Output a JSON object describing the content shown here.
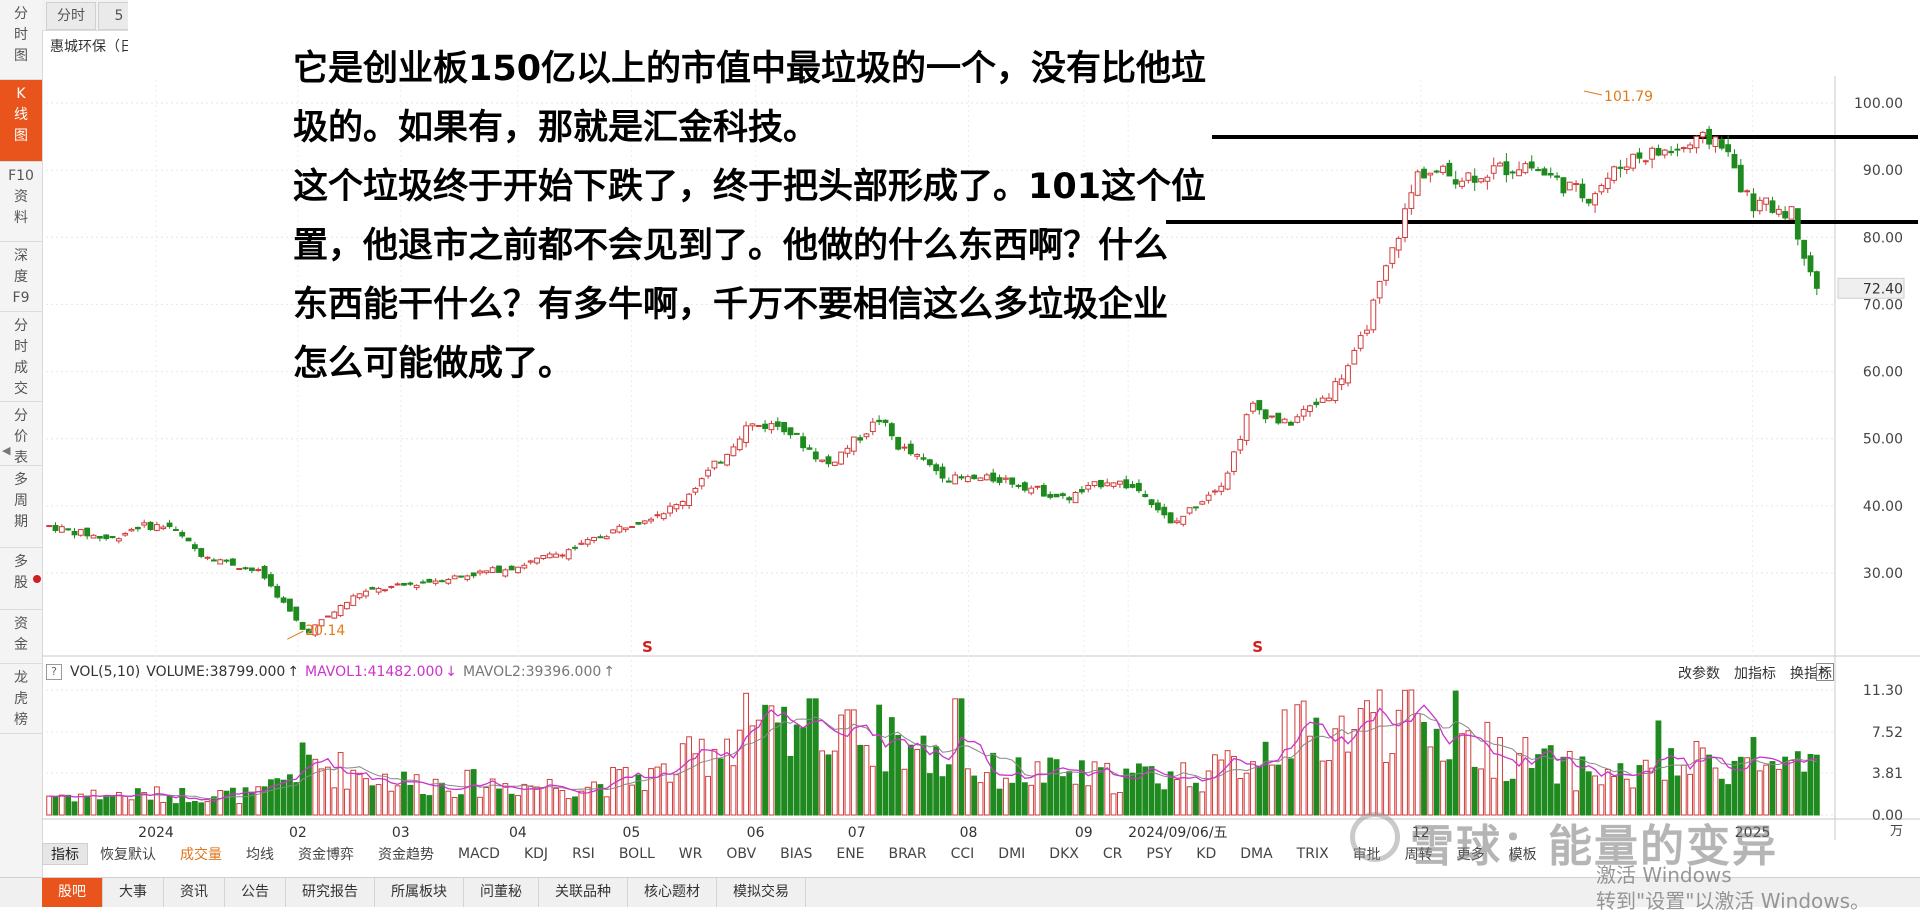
{
  "left_sidebar": {
    "items": [
      {
        "label": "分时图",
        "chars": [
          "分",
          "时",
          "图"
        ],
        "active": false
      },
      {
        "label": "K线图",
        "chars": [
          "K",
          "线",
          "图"
        ],
        "active": true
      },
      {
        "label": "F10资料",
        "chars": [
          "F10",
          "资",
          "料"
        ],
        "active": false
      },
      {
        "label": "深度F9",
        "chars": [
          "深",
          "度",
          "F9"
        ],
        "active": false
      },
      {
        "label": "分时成交",
        "chars": [
          "分",
          "时",
          "成",
          "交"
        ],
        "active": false
      },
      {
        "label": "分价表",
        "chars": [
          "分",
          "价",
          "表"
        ],
        "active": false
      },
      {
        "label": "多周期",
        "chars": [
          "多",
          "周",
          "期"
        ],
        "active": false
      },
      {
        "label": "多股",
        "chars": [
          "多",
          "股"
        ],
        "active": false
      },
      {
        "label": "资金",
        "chars": [
          "资",
          "金"
        ],
        "active": false
      },
      {
        "label": "龙虎榜",
        "chars": [
          "龙",
          "虎",
          "榜"
        ],
        "active": false
      }
    ]
  },
  "top_tabs": [
    "分时",
    "5"
  ],
  "stock_name": "惠城环保（日",
  "annotation_text": [
    "它是创业板150亿以上的市值中最垃圾的一个，没有比他垃",
    "圾的。如果有，那就是汇金科技。",
    "这个垃圾终于开始下跌了，终于把头部形成了。101这个位",
    "置，他退市之前都不会见到了。他做的什么东西啊？什么",
    "东西能干什么？有多牛啊，千万不要相信这么多垃圾企业",
    "怎么可能做成了。"
  ],
  "price_axis": {
    "ticks": [
      "100.00",
      "90.00",
      "80.00",
      "70.00",
      "60.00",
      "50.00",
      "40.00",
      "30.00"
    ],
    "current_price": "72.40"
  },
  "price_annotations": {
    "high_label": "101.79",
    "low_label": "20.14",
    "s_markers": [
      "S",
      "S"
    ]
  },
  "volume_legend": {
    "help": "?",
    "vol": "VOL(5,10)",
    "volume": "VOLUME:38799.000",
    "volume_arrow": "↑",
    "mavol1": "MAVOL1:41482.000",
    "mavol1_arrow": "↓",
    "mavol2": "MAVOL2:39396.000",
    "mavol2_arrow": "↑"
  },
  "volume_tools": [
    "改参数",
    "加指标",
    "换指标"
  ],
  "volume_close": "✕",
  "volume_axis": {
    "ticks": [
      "11.30",
      "7.52",
      "3.81",
      "0.00"
    ],
    "unit": "万"
  },
  "x_axis": {
    "labels": [
      "2024",
      "02",
      "03",
      "04",
      "05",
      "06",
      "07",
      "08",
      "09",
      "2024/09/06/五",
      "12",
      "2025"
    ]
  },
  "indicator_bar": {
    "items": [
      "指标",
      "恢复默认",
      "成交量",
      "均线",
      "资金博弈",
      "资金趋势",
      "MACD",
      "KDJ",
      "RSI",
      "BOLL",
      "WR",
      "OBV",
      "BIAS",
      "ENE",
      "BRAR",
      "CCI",
      "DMI",
      "DKX",
      "CR",
      "PSY",
      "KD",
      "DMA",
      "TRIX",
      "审批",
      "周转",
      "更多",
      "模板"
    ],
    "selected": "指标",
    "highlighted": "成交量"
  },
  "bottom_tabs": {
    "items": [
      "股吧",
      "大事",
      "资讯",
      "公告",
      "研究报告",
      "所属板块",
      "问董秘",
      "关联品种",
      "核心题材",
      "模拟交易"
    ],
    "active": "股吧"
  },
  "watermark_text": "雪球：能量的变异",
  "activate_windows": [
    "激活 Windows",
    "转到\"设置\"以激活 Windows。"
  ],
  "colors": {
    "up": "#d23c3c",
    "down": "#1f8a1f",
    "accent": "#e8541c",
    "mavol1": "#cc33cc",
    "mavol2": "#888888",
    "annotation_label": "#e07b1a"
  },
  "chart_data": {
    "type": "candlestick",
    "series_name": "惠城环保",
    "ylim": [
      20,
      102
    ],
    "price_keypoints": [
      {
        "x": 0.0,
        "p": 37
      },
      {
        "x": 0.035,
        "p": 35
      },
      {
        "x": 0.05,
        "p": 37
      },
      {
        "x": 0.068,
        "p": 37
      },
      {
        "x": 0.085,
        "p": 33
      },
      {
        "x": 0.12,
        "p": 30
      },
      {
        "x": 0.145,
        "p": 21
      },
      {
        "x": 0.16,
        "p": 24
      },
      {
        "x": 0.175,
        "p": 27
      },
      {
        "x": 0.22,
        "p": 29
      },
      {
        "x": 0.265,
        "p": 31
      },
      {
        "x": 0.3,
        "p": 34
      },
      {
        "x": 0.325,
        "p": 37
      },
      {
        "x": 0.355,
        "p": 40
      },
      {
        "x": 0.38,
        "p": 47
      },
      {
        "x": 0.395,
        "p": 52
      },
      {
        "x": 0.415,
        "p": 52
      },
      {
        "x": 0.44,
        "p": 46
      },
      {
        "x": 0.47,
        "p": 53
      },
      {
        "x": 0.48,
        "p": 49
      },
      {
        "x": 0.51,
        "p": 44
      },
      {
        "x": 0.54,
        "p": 44
      },
      {
        "x": 0.575,
        "p": 41
      },
      {
        "x": 0.6,
        "p": 44
      },
      {
        "x": 0.62,
        "p": 42
      },
      {
        "x": 0.635,
        "p": 37
      },
      {
        "x": 0.665,
        "p": 44
      },
      {
        "x": 0.68,
        "p": 55
      },
      {
        "x": 0.7,
        "p": 52
      },
      {
        "x": 0.725,
        "p": 57
      },
      {
        "x": 0.74,
        "p": 63
      },
      {
        "x": 0.76,
        "p": 78
      },
      {
        "x": 0.775,
        "p": 90
      },
      {
        "x": 0.8,
        "p": 89
      },
      {
        "x": 0.835,
        "p": 91
      },
      {
        "x": 0.87,
        "p": 86
      },
      {
        "x": 0.895,
        "p": 92
      },
      {
        "x": 0.92,
        "p": 93
      },
      {
        "x": 0.945,
        "p": 95
      },
      {
        "x": 0.962,
        "p": 85
      },
      {
        "x": 0.985,
        "p": 84
      },
      {
        "x": 1.0,
        "p": 72.4
      }
    ],
    "high": 101.79,
    "low": 20.14,
    "horizontal_lines": [
      95,
      83
    ],
    "volume_ylim": [
      0,
      11.3
    ],
    "volume_keypoints": [
      {
        "x": 0.0,
        "v": 1.8
      },
      {
        "x": 0.12,
        "v": 1.8
      },
      {
        "x": 0.145,
        "v": 4.8
      },
      {
        "x": 0.2,
        "v": 3.0
      },
      {
        "x": 0.3,
        "v": 2.6
      },
      {
        "x": 0.35,
        "v": 3.8
      },
      {
        "x": 0.395,
        "v": 8.0
      },
      {
        "x": 0.43,
        "v": 6.0
      },
      {
        "x": 0.47,
        "v": 7.0
      },
      {
        "x": 0.52,
        "v": 4.0
      },
      {
        "x": 0.6,
        "v": 3.4
      },
      {
        "x": 0.66,
        "v": 3.8
      },
      {
        "x": 0.7,
        "v": 7.0
      },
      {
        "x": 0.76,
        "v": 8.5
      },
      {
        "x": 0.8,
        "v": 6.5
      },
      {
        "x": 0.86,
        "v": 4.0
      },
      {
        "x": 0.9,
        "v": 3.5
      },
      {
        "x": 0.94,
        "v": 5.0
      },
      {
        "x": 1.0,
        "v": 3.8
      }
    ],
    "volume_spikes": [
      {
        "x": 0.394,
        "v": 11.0
      },
      {
        "x": 0.432,
        "v": 10.5
      },
      {
        "x": 0.454,
        "v": 9.5
      },
      {
        "x": 0.476,
        "v": 8.8
      },
      {
        "x": 0.515,
        "v": 10.5
      },
      {
        "x": 0.7,
        "v": 9.5
      },
      {
        "x": 0.752,
        "v": 11.3
      },
      {
        "x": 0.796,
        "v": 11.2
      },
      {
        "x": 0.91,
        "v": 8.5
      },
      {
        "x": 0.965,
        "v": 7.0
      }
    ]
  }
}
